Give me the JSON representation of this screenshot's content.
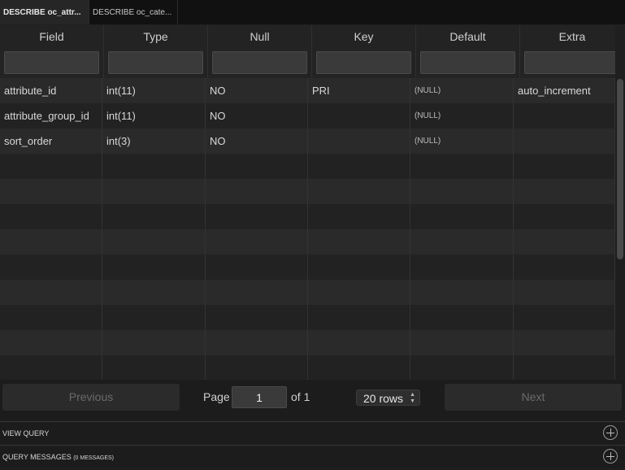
{
  "tabs": [
    {
      "label": "DESCRIBE oc_attr...",
      "active": true
    },
    {
      "label": "DESCRIBE oc_cate...",
      "active": false
    }
  ],
  "columns": [
    "Field",
    "Type",
    "Null",
    "Key",
    "Default",
    "Extra"
  ],
  "rows": [
    {
      "field": "attribute_id",
      "type": "int(11)",
      "null": "NO",
      "key": "PRI",
      "default": "(NULL)",
      "extra": "auto_increment"
    },
    {
      "field": "attribute_group_id",
      "type": "int(11)",
      "null": "NO",
      "key": "",
      "default": "(NULL)",
      "extra": ""
    },
    {
      "field": "sort_order",
      "type": "int(3)",
      "null": "NO",
      "key": "",
      "default": "(NULL)",
      "extra": ""
    }
  ],
  "pagination": {
    "previous_label": "Previous",
    "next_label": "Next",
    "page_label": "Page",
    "page_value": "1",
    "of_label": "of 1",
    "rows_selected": "20 rows"
  },
  "panels": {
    "view_query": "VIEW QUERY",
    "query_messages": "QUERY MESSAGES",
    "query_messages_count": "(0 MESSAGES)"
  }
}
